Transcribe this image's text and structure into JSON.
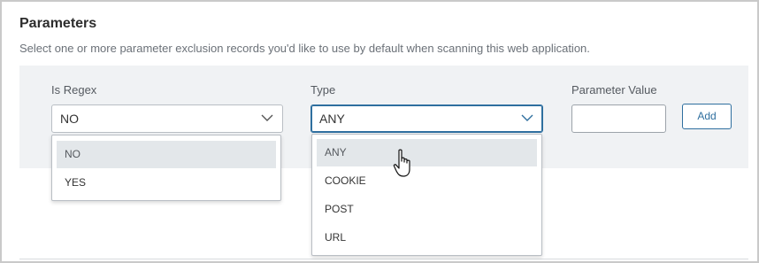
{
  "section": {
    "title": "Parameters",
    "subtitle": "Select one or more parameter exclusion records you'd like to use by default when scanning this web application."
  },
  "fields": {
    "is_regex": {
      "label": "Is Regex",
      "value": "NO",
      "options": [
        "NO",
        "YES"
      ],
      "highlighted": "NO"
    },
    "type": {
      "label": "Type",
      "value": "ANY",
      "options": [
        "ANY",
        "COOKIE",
        "POST",
        "URL"
      ],
      "highlighted": "ANY"
    },
    "parameter_value": {
      "label": "Parameter Value",
      "value": ""
    }
  },
  "actions": {
    "add_label": "Add"
  },
  "colors": {
    "accent": "#2f6f9f",
    "panel_bg": "#f0f2f4",
    "highlight_bg": "#e3e7ea"
  },
  "icons": {
    "dropdown": "chevron-down-icon",
    "pointer": "hand-pointer-icon"
  }
}
